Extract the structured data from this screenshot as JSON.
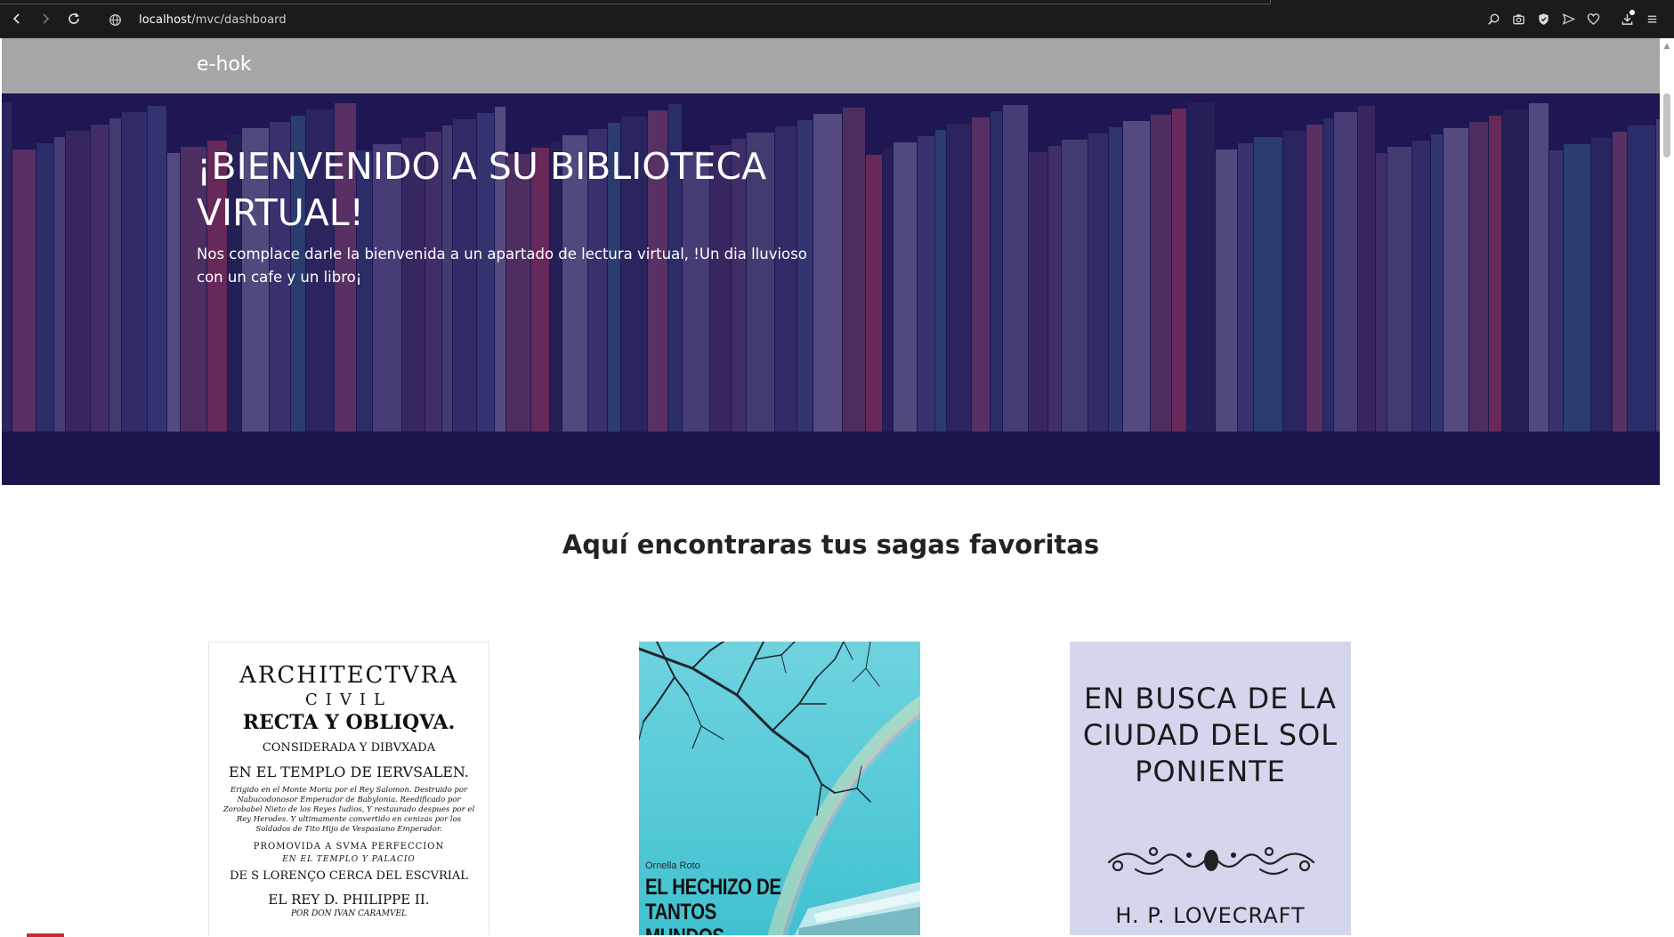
{
  "browser": {
    "url_host": "localhost",
    "url_path": "/mvc/dashboard"
  },
  "navbar": {
    "brand": "e-hok"
  },
  "hero": {
    "title": "¡BIENVENIDO A SU BIBLIOTECA VIRTUAL!",
    "text": "Nos complace darle la bienvenida a un apartado de lectura virtual, !Un dia lluvioso con un cafe y un libro¡"
  },
  "sagas": {
    "heading": "Aquí encontraras tus sagas favoritas",
    "books": [
      {
        "lines": [
          "ARCHITECTVRA",
          "CIVIL",
          "RECTA Y OBLIQVA.",
          "CONSIDERADA Y DIBVXADA",
          "EN EL TEMPLO DE IERVSALEN.",
          "Erigido en el Monte Moria por el Rey Salomon. Destruido por Nabucodonosor Emperador de Babylonia. Reedificado por Zorobabel Nieto de los Reyes Iudios, Y restaurado despues por el Rey Herodes. Y ultimamente convertido en cenizas por los Soldados de Tito Hijo de Vespasiano Emperador.",
          "PROMOVIDA A SVMA PERFECCION",
          "EN EL TEMPLO Y PALACIO",
          "DE S LORENÇO CERCA DEL ESCVRIAL",
          "EL REY D. PHILIPPE II.",
          "POR DON IVAN CARAMVEL"
        ]
      },
      {
        "author": "Ornella Roto",
        "title": "EL HECHIZO DE TANTOS MUNDOS"
      },
      {
        "title": "EN BUSCA DE LA CIUDAD DEL SOL PONIENTE",
        "author": "H. P. LOVECRAFT"
      }
    ]
  }
}
